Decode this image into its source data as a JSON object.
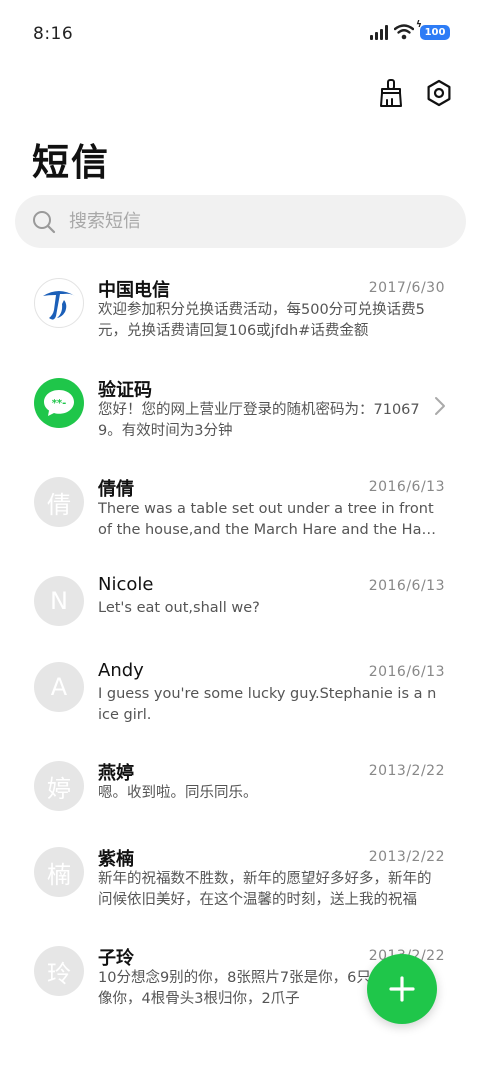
{
  "status_bar": {
    "time": "8:16",
    "battery_level": "100"
  },
  "header": {
    "title": "短信",
    "actions": [
      "clean-icon",
      "settings-icon"
    ]
  },
  "search": {
    "placeholder": "搜索短信"
  },
  "conversations": [
    {
      "name": "中国电信",
      "date": "2017/6/30",
      "preview": "欢迎参加积分兑换话费活动，每500分可兑换话费5元，兑换话费请回复106或jfdh#话费金额",
      "avatar": "china-telecom-logo"
    },
    {
      "name": "验证码",
      "date": "",
      "preview": "您好！您的网上营业厅登录的随机密码为：710679。有效时间为3分钟",
      "avatar": "verification-code-icon",
      "avatar_text": "**-"
    },
    {
      "name": "倩倩",
      "date": "2016/6/13",
      "preview": "There was a table set out under a tree in front of the house,and the March Hare and the Hatter were having tea",
      "avatar_letter": "倩"
    },
    {
      "name": "Nicole",
      "date": "2016/6/13",
      "preview": "Let's eat out,shall we?",
      "avatar_letter": "N"
    },
    {
      "name": "Andy",
      "date": "2016/6/13",
      "preview": "I guess you're some lucky guy.Stephanie is a nice girl.",
      "avatar_letter": "A"
    },
    {
      "name": "燕婷",
      "date": "2013/2/22",
      "preview": "嗯。收到啦。同乐同乐。",
      "avatar_letter": "婷"
    },
    {
      "name": "紫楠",
      "date": "2013/2/22",
      "preview": "新年的祝福数不胜数，新年的愿望好多好多，新年的问候依旧美好，在这个温馨的时刻，送上我的祝福",
      "avatar_letter": "楠"
    },
    {
      "name": "子玲",
      "date": "2013/2/22",
      "preview": "10分想念9别的你，8张照片7张是你，6只小狗5只像你，4根骨头3根归你，2爪子",
      "avatar_letter": "玲"
    }
  ],
  "colors": {
    "accent_green": "#1fc64a",
    "telecom_blue": "#1b5fb8",
    "battery_blue": "#2d7cf6"
  }
}
